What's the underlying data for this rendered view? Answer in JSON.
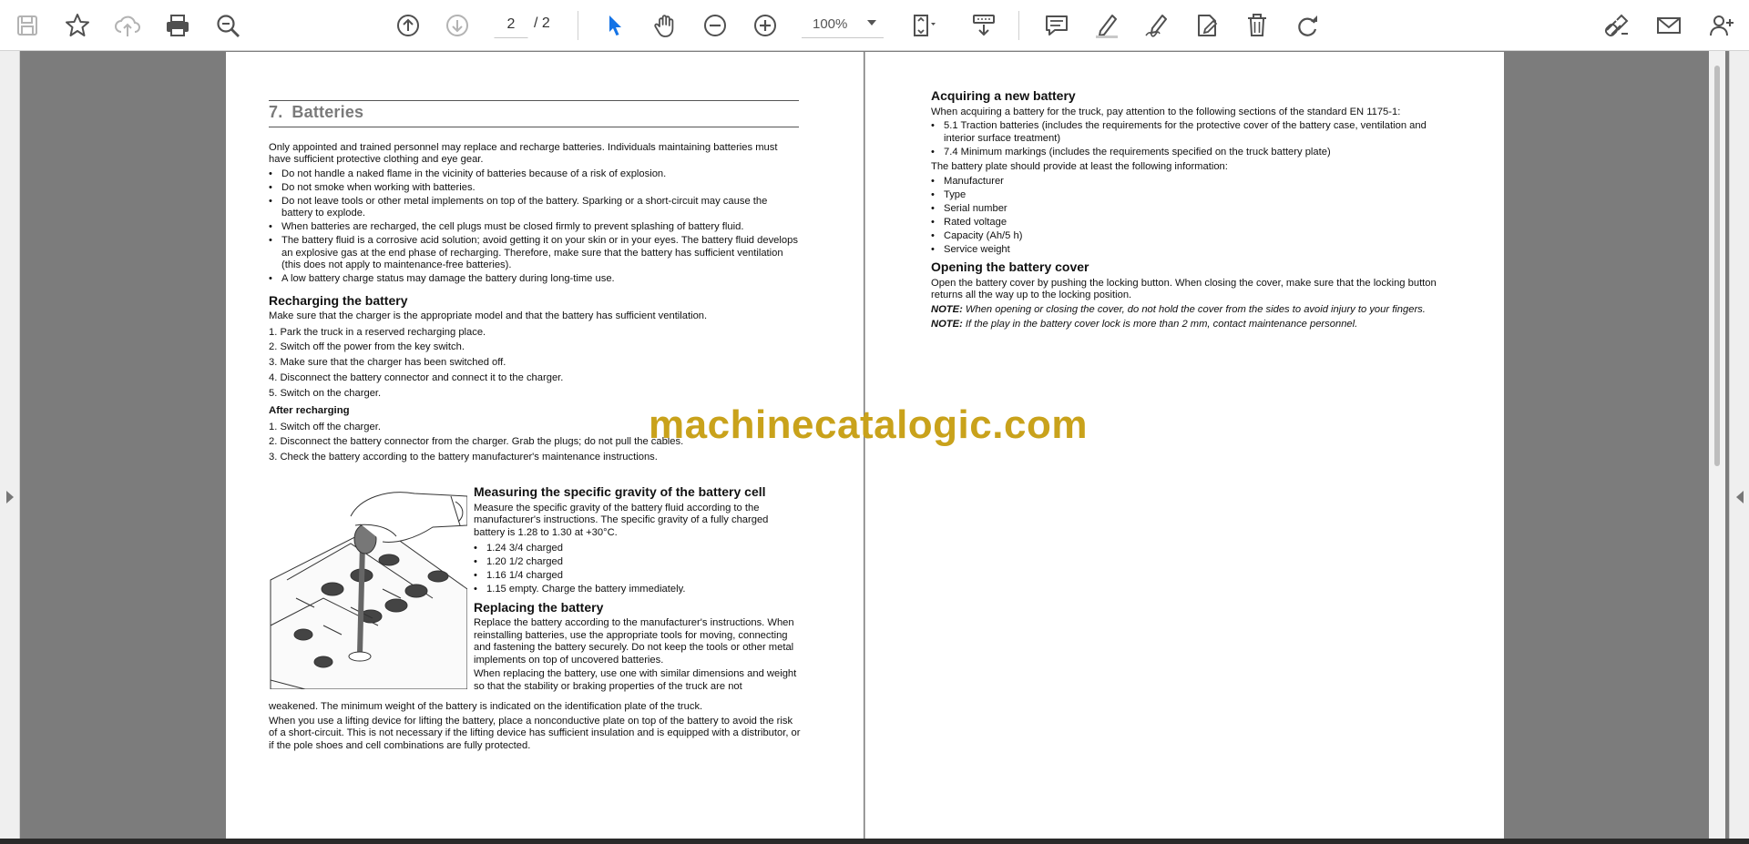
{
  "toolbar": {
    "page_current": "2",
    "page_total": "/ 2",
    "zoom": "100%",
    "icons": [
      "save-icon",
      "bookmark-star-icon",
      "cloud-upload-icon",
      "print-icon",
      "zoom-search-icon",
      "page-up-icon",
      "page-down-icon",
      "select-cursor-icon",
      "hand-tool-icon",
      "zoom-out-icon",
      "zoom-in-icon",
      "fit-page-icon",
      "scroll-mode-icon",
      "comment-icon",
      "highlight-pen-icon",
      "sign-icon",
      "stamp-icon",
      "delete-icon",
      "rotate-icon",
      "share-link-icon",
      "email-icon",
      "add-user-icon"
    ]
  },
  "colors": {
    "accent": "#1473e6",
    "watermark": "#c9a21b",
    "background": "#7c7c7c"
  },
  "watermark": "machinecatalogic.com",
  "left": {
    "title_num": "7.",
    "title": "Batteries",
    "intro": "Only appointed and trained personnel may replace and recharge batteries. Individuals maintaining batteries must have sufficient protective clothing and eye gear.",
    "bullets": [
      "Do not handle a naked flame in the vicinity of batteries because of a risk of explosion.",
      "Do not smoke when working with batteries.",
      "Do not leave tools or other metal implements on top of the battery. Sparking or a short-circuit may cause the battery to explode.",
      "When batteries are recharged, the cell plugs must be closed firmly to prevent splashing of battery fluid.",
      "The battery fluid is a corrosive acid solution; avoid getting it on your skin or in your eyes. The battery fluid develops an explosive gas at the end phase of recharging. Therefore, make sure that the battery has sufficient ventilation (this does not apply to maintenance-free batteries).",
      "A low battery charge status may damage the battery during long-time use."
    ],
    "recharge_title": "Recharging the battery",
    "recharge_intro": "Make sure that the charger is the appropriate model and that the battery has sufficient ventilation.",
    "recharge_steps": [
      "1. Park the truck in a reserved recharging place.",
      "2. Switch off the power from the key switch.",
      "3. Make sure that the charger has been switched off.",
      "4. Disconnect the battery connector and connect it to the charger.",
      "5. Switch on the charger."
    ],
    "after_title": "After recharging",
    "after_steps": [
      "1. Switch off the charger.",
      "2. Disconnect the battery connector from the charger. Grab the plugs; do not pull the cables.",
      "3. Check the battery according to the battery manufacturer's maintenance instructions."
    ],
    "gravity_title": "Measuring the specific gravity of the battery cell",
    "gravity_text": "Measure the specific gravity of the battery fluid according to the manufacturer's instructions. The specific gravity of a fully charged battery is 1.28 to 1.30 at +30°C.",
    "gravity_bullets": [
      "1.24 3/4 charged",
      "1.20 1/2 charged",
      "1.16 1/4 charged",
      "1.15 empty. Charge the battery immediately."
    ],
    "replace_title": "Replacing the battery",
    "replace_text1": "Replace the battery according to the manufacturer's instructions. When reinstalling batteries, use the appropriate tools for moving, connecting and fastening the battery securely. Do not keep the tools or other metal implements on top of uncovered batteries.",
    "replace_text2a": "When replacing the battery, use one with similar dimensions and weight so that the stability or braking properties of the truck are not",
    "replace_text2b": "weakened. The minimum weight of the battery is indicated on the identification plate of the truck.",
    "replace_text3": "When you use a lifting device for lifting the battery, place a nonconductive plate on top of the battery to avoid the risk of a short-circuit. This is not necessary if the lifting device has sufficient insulation and is equipped with a distributor, or if the pole shoes and cell combinations are fully protected."
  },
  "right": {
    "acquire_title": "Acquiring a new battery",
    "acquire_intro": "When acquiring a battery for the truck, pay attention to the following sections of the standard EN 1175-1:",
    "acquire_bullets": [
      "5.1 Traction batteries (includes the requirements for the protective cover of the battery case, ventilation and interior surface treatment)",
      "7.4 Minimum markings (includes the requirements specified on the truck battery plate)"
    ],
    "plate_intro": "The battery plate should provide at least the following information:",
    "plate_bullets": [
      "Manufacturer",
      "Type",
      "Serial number",
      "Rated voltage",
      "Capacity (Ah/5 h)",
      "Service weight"
    ],
    "cover_title": "Opening the battery cover",
    "cover_text": "Open the battery cover by pushing the locking button. When closing the cover, make sure that the locking button returns all the way up to the locking position.",
    "note_label": "NOTE:",
    "note1": "When opening or closing the cover, do not hold the cover from the sides to avoid injury to your fingers.",
    "note2": "If the play in the battery cover lock is more than 2 mm, contact maintenance personnel."
  }
}
